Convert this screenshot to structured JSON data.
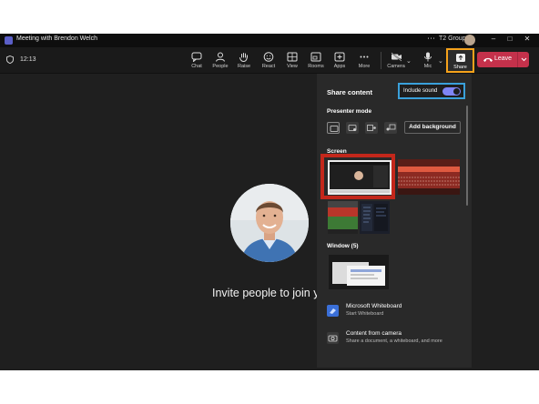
{
  "window": {
    "title": "Meeting with Brendon Welch",
    "org": "T2 Group"
  },
  "window_controls": {
    "more": "⋯",
    "minimize": "–",
    "maximize": "□",
    "close": "✕"
  },
  "meeting": {
    "elapsed": "12:13"
  },
  "toolbar": {
    "chat": "Chat",
    "people": "People",
    "raise": "Raise",
    "react": "React",
    "view": "View",
    "rooms": "Rooms",
    "apps": "Apps",
    "more": "More",
    "camera": "Camera",
    "mic": "Mic",
    "share": "Share",
    "leave": "Leave"
  },
  "stage": {
    "invite_text": "Invite people to join you"
  },
  "share_panel": {
    "title": "Share content",
    "include_sound_label": "Include sound",
    "include_sound_on": true,
    "presenter_mode_label": "Presenter mode",
    "add_background_label": "Add background",
    "screen_label": "Screen",
    "window_label": "Window (5)",
    "items": [
      {
        "title": "Microsoft Whiteboard",
        "subtitle": "Start Whiteboard"
      },
      {
        "title": "Content from camera",
        "subtitle": "Share a document, a whiteboard, and more"
      }
    ]
  },
  "colors": {
    "accent": "#7f85f5",
    "leave": "#c4314b",
    "share_highlight": "#f5a21b",
    "sound_highlight": "#3aa0da",
    "screen_highlight": "#c3271b"
  }
}
